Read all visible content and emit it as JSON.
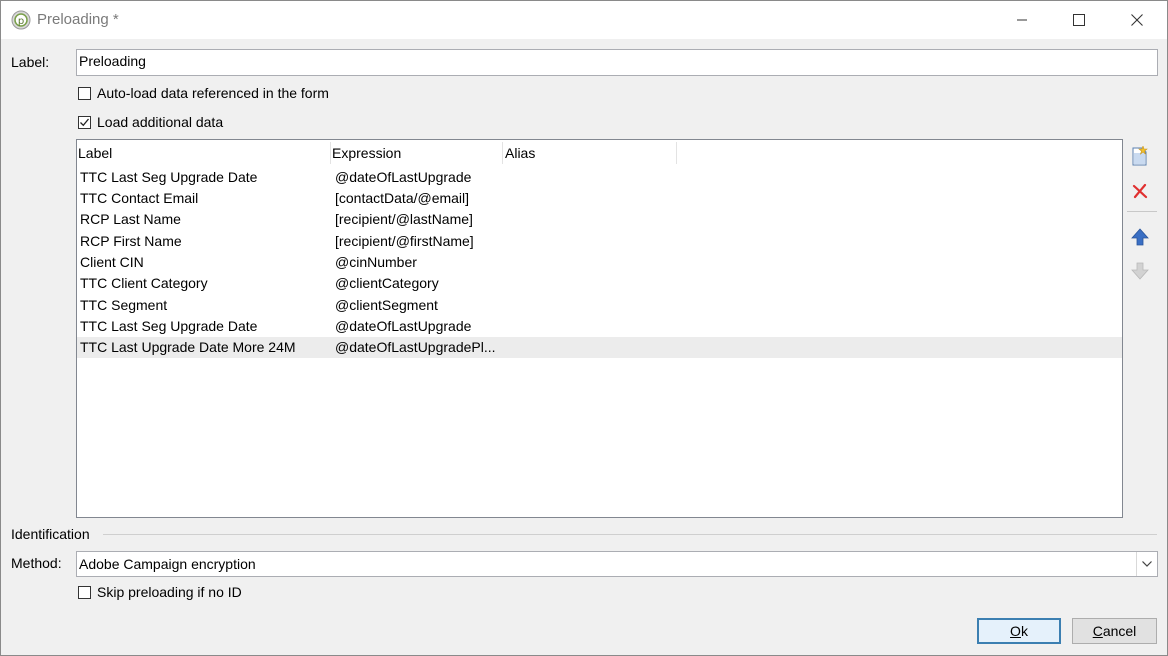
{
  "window": {
    "title": "Preloading *",
    "minimize_icon": "minimize-icon",
    "maximize_icon": "maximize-icon",
    "close_icon": "close-icon"
  },
  "form": {
    "label_caption": "Label:",
    "label_value": "Preloading",
    "autoload": {
      "text": "Auto-load data referenced in the form",
      "checked": false
    },
    "load_additional": {
      "text": "Load additional data",
      "checked": true
    }
  },
  "grid": {
    "columns": [
      "Label",
      "Expression",
      "Alias"
    ],
    "rows": [
      {
        "label": "TTC Last Seg Upgrade Date",
        "expression": "@dateOfLastUpgrade",
        "alias": ""
      },
      {
        "label": "TTC Contact Email",
        "expression": "[contactData/@email]",
        "alias": ""
      },
      {
        "label": "RCP Last Name",
        "expression": "[recipient/@lastName]",
        "alias": ""
      },
      {
        "label": "RCP First Name",
        "expression": "[recipient/@firstName]",
        "alias": ""
      },
      {
        "label": "Client CIN",
        "expression": "@cinNumber",
        "alias": ""
      },
      {
        "label": "TTC Client Category",
        "expression": "@clientCategory",
        "alias": ""
      },
      {
        "label": "TTC Segment",
        "expression": "@clientSegment",
        "alias": ""
      },
      {
        "label": "TTC Last Seg Upgrade Date",
        "expression": "@dateOfLastUpgrade",
        "alias": ""
      },
      {
        "label": "TTC Last Upgrade Date More 24M",
        "expression": "@dateOfLastUpgradePl...",
        "alias": ""
      }
    ],
    "selected_row": 8
  },
  "side_toolbar": {
    "add_icon": "add-document-icon",
    "delete_icon": "delete-icon",
    "up_icon": "move-up-icon",
    "down_icon": "move-down-icon"
  },
  "identification": {
    "group_label": "Identification",
    "method_caption": "Method:",
    "method_value": "Adobe Campaign encryption",
    "skip": {
      "text": "Skip preloading if no ID",
      "checked": false
    }
  },
  "buttons": {
    "ok_underlined": "O",
    "ok_rest": "k",
    "cancel_underlined": "C",
    "cancel_rest": "ancel"
  },
  "colors": {
    "accent": "#3c7fb1",
    "delete_red": "#e03030",
    "arrow_blue": "#3a6fc4",
    "selected_row_bg": "#ececec"
  }
}
